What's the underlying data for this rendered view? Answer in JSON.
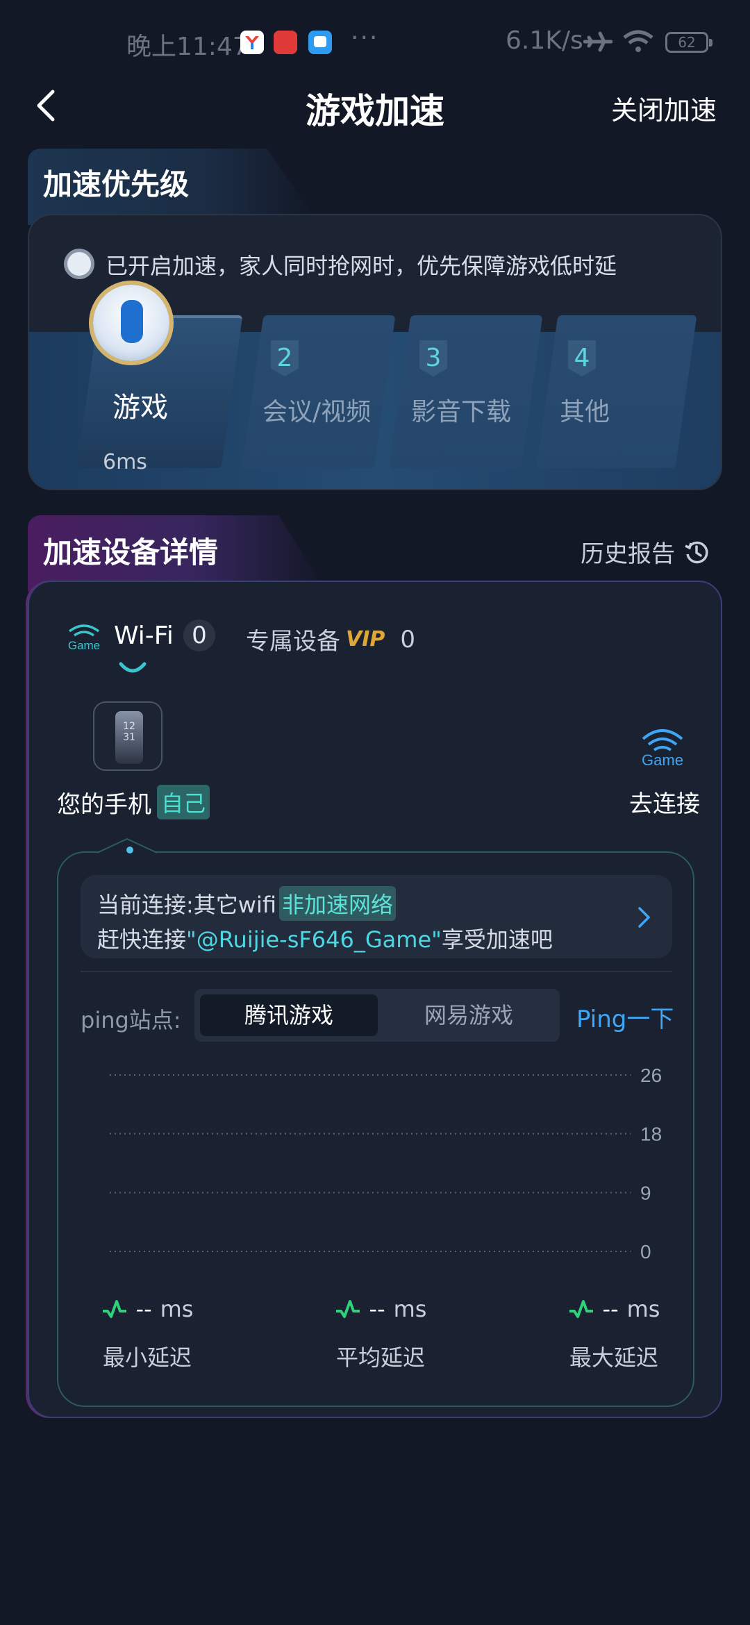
{
  "status_bar": {
    "time": "晚上11:47",
    "dots": "···",
    "net_speed": "6.1K/s",
    "battery": "62"
  },
  "header": {
    "title": "游戏加速",
    "close_label": "关闭加速"
  },
  "priority": {
    "section_title": "加速优先级",
    "notice": "已开启加速，家人同时抢网时，优先保障游戏低时延",
    "items": [
      {
        "label": "游戏",
        "latency": "6ms",
        "active": true
      },
      {
        "num": "2",
        "label": "会议/视频"
      },
      {
        "num": "3",
        "label": "影音下载"
      },
      {
        "num": "4",
        "label": "其他"
      }
    ]
  },
  "devices": {
    "section_title": "加速设备详情",
    "history_label": "历史报告",
    "wifi_tab": {
      "label": "Wi-Fi",
      "count": "0"
    },
    "vip_tab": {
      "label": "专属设备",
      "badge": "VIP",
      "count": "0"
    },
    "my_phone": {
      "label": "您的手机",
      "tag": "自己",
      "clock": "12 31"
    },
    "go_connect_label": "去连接",
    "game_icon_text": "Game",
    "connection": {
      "prefix": "当前连接:其它wifi",
      "status": "非加速网络",
      "line2_prefix": "赶快连接",
      "ssid": "\"@Ruijie-sF646_Game\"",
      "line2_suffix": "享受加速吧"
    },
    "ping": {
      "label": "ping站点:",
      "options": [
        "腾讯游戏",
        "网易游戏"
      ],
      "selected": "腾讯游戏",
      "button": "Ping一下"
    },
    "stats": [
      {
        "value": "--",
        "unit": "ms",
        "label": "最小延迟"
      },
      {
        "value": "--",
        "unit": "ms",
        "label": "平均延迟"
      },
      {
        "value": "--",
        "unit": "ms",
        "label": "最大延迟"
      }
    ]
  },
  "chart_data": {
    "type": "line",
    "y_ticks": [
      "26",
      "18",
      "9",
      "0"
    ],
    "ylim": [
      0,
      26
    ],
    "series": [],
    "grid": "dotted horizontal"
  },
  "colors": {
    "background": "#121826",
    "accent_cyan": "#4ed6e3",
    "accent_blue": "#3fa6f5",
    "pulse_green": "#2fd17a",
    "vip_gold": "#e0a636"
  }
}
